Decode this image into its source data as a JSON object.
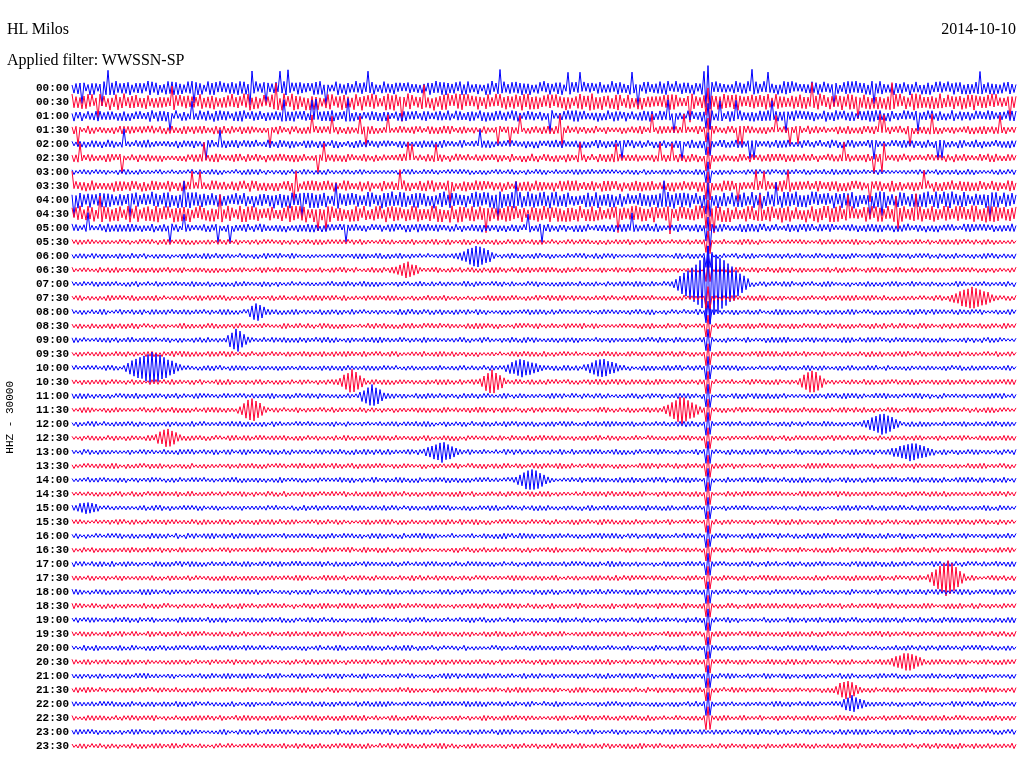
{
  "station": "HL Milos",
  "date": "2014-10-10",
  "filter_label": "Applied filter: WWSSN-SP",
  "channel_label": "HHZ - 30000",
  "rows": [
    {
      "time": "00:00",
      "color": "#0000ff"
    },
    {
      "time": "00:30",
      "color": "#ff0033"
    },
    {
      "time": "01:00",
      "color": "#0000ff"
    },
    {
      "time": "01:30",
      "color": "#ff0033"
    },
    {
      "time": "02:00",
      "color": "#0000ff"
    },
    {
      "time": "02:30",
      "color": "#ff0033"
    },
    {
      "time": "03:00",
      "color": "#0000ff"
    },
    {
      "time": "03:30",
      "color": "#ff0033"
    },
    {
      "time": "04:00",
      "color": "#0000ff"
    },
    {
      "time": "04:30",
      "color": "#ff0033"
    },
    {
      "time": "05:00",
      "color": "#0000ff"
    },
    {
      "time": "05:30",
      "color": "#ff0033"
    },
    {
      "time": "06:00",
      "color": "#0000ff"
    },
    {
      "time": "06:30",
      "color": "#ff0033"
    },
    {
      "time": "07:00",
      "color": "#0000ff"
    },
    {
      "time": "07:30",
      "color": "#ff0033"
    },
    {
      "time": "08:00",
      "color": "#0000ff"
    },
    {
      "time": "08:30",
      "color": "#ff0033"
    },
    {
      "time": "09:00",
      "color": "#0000ff"
    },
    {
      "time": "09:30",
      "color": "#ff0033"
    },
    {
      "time": "10:00",
      "color": "#0000ff"
    },
    {
      "time": "10:30",
      "color": "#ff0033"
    },
    {
      "time": "11:00",
      "color": "#0000ff"
    },
    {
      "time": "11:30",
      "color": "#ff0033"
    },
    {
      "time": "12:00",
      "color": "#0000ff"
    },
    {
      "time": "12:30",
      "color": "#ff0033"
    },
    {
      "time": "13:00",
      "color": "#0000ff"
    },
    {
      "time": "13:30",
      "color": "#ff0033"
    },
    {
      "time": "14:00",
      "color": "#0000ff"
    },
    {
      "time": "14:30",
      "color": "#ff0033"
    },
    {
      "time": "15:00",
      "color": "#0000ff"
    },
    {
      "time": "15:30",
      "color": "#ff0033"
    },
    {
      "time": "16:00",
      "color": "#0000ff"
    },
    {
      "time": "16:30",
      "color": "#ff0033"
    },
    {
      "time": "17:00",
      "color": "#0000ff"
    },
    {
      "time": "17:30",
      "color": "#ff0033"
    },
    {
      "time": "18:00",
      "color": "#0000ff"
    },
    {
      "time": "18:30",
      "color": "#ff0033"
    },
    {
      "time": "19:00",
      "color": "#0000ff"
    },
    {
      "time": "19:30",
      "color": "#ff0033"
    },
    {
      "time": "20:00",
      "color": "#0000ff"
    },
    {
      "time": "20:30",
      "color": "#ff0033"
    },
    {
      "time": "21:00",
      "color": "#0000ff"
    },
    {
      "time": "21:30",
      "color": "#ff0033"
    },
    {
      "time": "22:00",
      "color": "#0000ff"
    },
    {
      "time": "22:30",
      "color": "#ff0033"
    },
    {
      "time": "23:00",
      "color": "#0000ff"
    },
    {
      "time": "23:30",
      "color": "#ff0033"
    }
  ]
}
